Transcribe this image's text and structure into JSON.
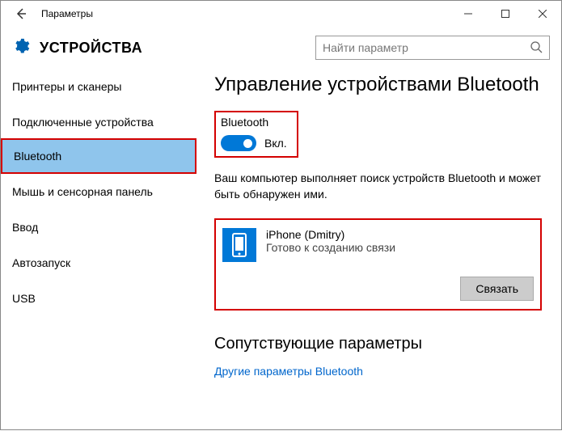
{
  "window": {
    "title": "Параметры"
  },
  "header": {
    "title": "УСТРОЙСТВА",
    "search_placeholder": "Найти параметр"
  },
  "sidebar": {
    "items": [
      {
        "label": "Принтеры и сканеры"
      },
      {
        "label": "Подключенные устройства"
      },
      {
        "label": "Bluetooth",
        "selected": true
      },
      {
        "label": "Мышь и сенсорная панель"
      },
      {
        "label": "Ввод"
      },
      {
        "label": "Автозапуск"
      },
      {
        "label": "USB"
      }
    ]
  },
  "page": {
    "title": "Управление устройствами Bluetooth",
    "bluetooth_label": "Bluetooth",
    "toggle_state": "Вкл.",
    "info_text": "Ваш компьютер выполняет поиск устройств Bluetooth и может быть обнаружен ими.",
    "device": {
      "name": "iPhone (Dmitry)",
      "status": "Готово к созданию связи",
      "pair_label": "Связать"
    },
    "related_title": "Сопутствующие параметры",
    "related_link": "Другие параметры Bluetooth"
  }
}
